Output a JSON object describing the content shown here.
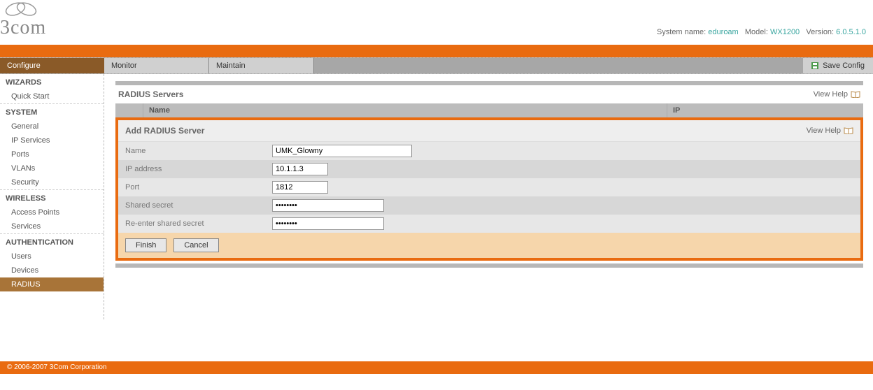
{
  "header": {
    "logo_text": "3com",
    "sys_name_label": "System name:",
    "sys_name_value": "eduroam",
    "model_label": "Model:",
    "model_value": "WX1200",
    "version_label": "Version:",
    "version_value": "6.0.5.1.0"
  },
  "tabs": {
    "configure": "Configure",
    "monitor": "Monitor",
    "maintain": "Maintain",
    "save_config": "Save Config"
  },
  "sidebar": {
    "wizards": {
      "title": "WIZARDS",
      "items": [
        "Quick Start"
      ]
    },
    "system": {
      "title": "SYSTEM",
      "items": [
        "General",
        "IP Services",
        "Ports",
        "VLANs",
        "Security"
      ]
    },
    "wireless": {
      "title": "WIRELESS",
      "items": [
        "Access Points",
        "Services"
      ]
    },
    "auth": {
      "title": "AUTHENTICATION",
      "items": [
        "Users",
        "Devices",
        "RADIUS"
      ]
    }
  },
  "page": {
    "title": "RADIUS Servers",
    "view_help": "View Help",
    "col_name": "Name",
    "col_ip": "IP"
  },
  "form": {
    "title": "Add RADIUS Server",
    "view_help": "View Help",
    "name_label": "Name",
    "name_value": "UMK_Glowny",
    "ip_label": "IP address",
    "ip_value": "10.1.1.3",
    "port_label": "Port",
    "port_value": "1812",
    "secret_label": "Shared secret",
    "secret_value": "********",
    "secret2_label": "Re-enter shared secret",
    "secret2_value": "********",
    "finish": "Finish",
    "cancel": "Cancel"
  },
  "footer": "© 2006-2007 3Com Corporation"
}
